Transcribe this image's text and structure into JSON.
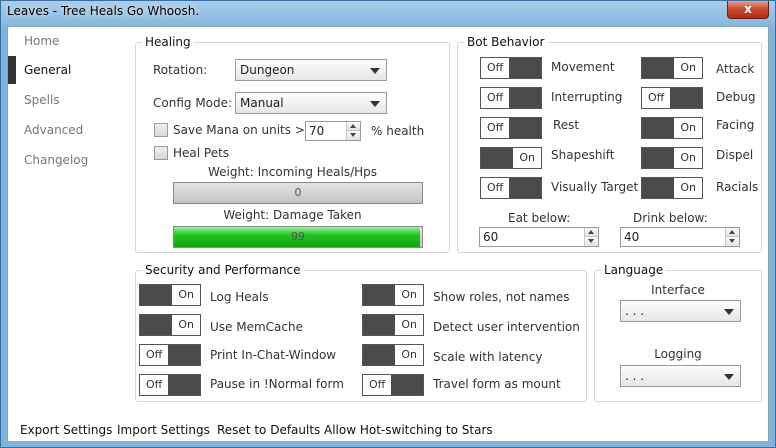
{
  "window": {
    "title": "Leaves - Tree Heals Go Whoosh.",
    "close_glyph": "x"
  },
  "nav": {
    "items": [
      "Home",
      "General",
      "Spells",
      "Advanced",
      "Changelog"
    ],
    "active": "General"
  },
  "healing": {
    "title": "Healing",
    "rotation_label": "Rotation:",
    "rotation_value": "Dungeon",
    "config_mode_label": "Config Mode:",
    "config_mode_value": "Manual",
    "save_mana_label": "Save Mana on units >=",
    "save_mana_value": "70",
    "save_mana_unit": "% health",
    "heal_pets_label": "Heal Pets",
    "weight_incoming_label": "Weight: Incoming Heals/Hps",
    "weight_incoming_value": "0",
    "weight_incoming_fraction": 0,
    "weight_damage_label": "Weight: Damage Taken",
    "weight_damage_value": "99",
    "weight_damage_fraction": 0.99
  },
  "bot": {
    "title": "Bot Behavior",
    "toggles_left": [
      {
        "label": "Movement",
        "state": "Off"
      },
      {
        "label": "Interrupting",
        "state": "Off"
      },
      {
        "label": "Rest",
        "state": "Off"
      },
      {
        "label": "Shapeshift",
        "state": "On"
      },
      {
        "label": "Visually Target",
        "state": "Off"
      }
    ],
    "toggles_right": [
      {
        "label": "Attack",
        "state": "On"
      },
      {
        "label": "Debug",
        "state": "Off"
      },
      {
        "label": "Facing",
        "state": "On"
      },
      {
        "label": "Dispel",
        "state": "On"
      },
      {
        "label": "Racials",
        "state": "On"
      }
    ],
    "eat_label": "Eat below:",
    "eat_value": "60",
    "drink_label": "Drink below:",
    "drink_value": "40"
  },
  "security": {
    "title": "Security and Performance",
    "toggles_left": [
      {
        "label": "Log Heals",
        "state": "On"
      },
      {
        "label": "Use MemCache",
        "state": "On"
      },
      {
        "label": "Print In-Chat-Window",
        "state": "Off"
      },
      {
        "label": "Pause in !Normal form",
        "state": "Off"
      }
    ],
    "toggles_right": [
      {
        "label": "Show roles, not names",
        "state": "On"
      },
      {
        "label": "Detect user intervention",
        "state": "On"
      },
      {
        "label": "Scale with latency",
        "state": "On"
      },
      {
        "label": "Travel form as mount",
        "state": "Off"
      }
    ]
  },
  "language": {
    "title": "Language",
    "interface_label": "Interface",
    "interface_value": ". . .",
    "logging_label": "Logging",
    "logging_value": ". . ."
  },
  "footer": {
    "export": "Export Settings",
    "import": "Import Settings",
    "reset": "Reset to Defaults",
    "hotswitch": "Allow Hot-switching to Stars"
  }
}
